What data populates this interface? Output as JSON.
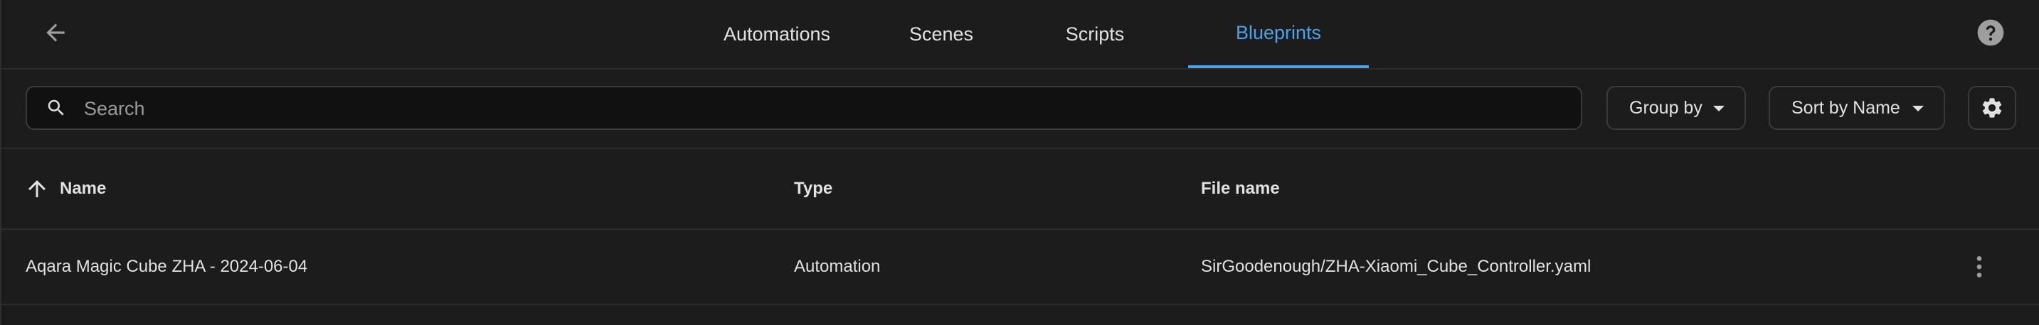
{
  "header": {
    "tabs": [
      {
        "label": "Automations",
        "active": false
      },
      {
        "label": "Scenes",
        "active": false
      },
      {
        "label": "Scripts",
        "active": false
      },
      {
        "label": "Blueprints",
        "active": true
      }
    ],
    "back_icon": "arrow-left-icon",
    "help_icon": "help-circle-icon"
  },
  "toolbar": {
    "search_placeholder": "Search",
    "search_value": "",
    "group_by_label": "Group by",
    "sort_by_label": "Sort by Name",
    "settings_icon": "gear-icon"
  },
  "table": {
    "columns": [
      "Name",
      "Type",
      "File name"
    ],
    "sort_icon": "arrow-up-icon",
    "rows": [
      {
        "name": "Aqara Magic Cube ZHA - 2024-06-04",
        "type": "Automation",
        "file_name": "SirGoodenough/ZHA-Xiaomi_Cube_Controller.yaml"
      }
    ]
  },
  "colors": {
    "accent": "#4aa3e8",
    "background": "#111111",
    "surface": "#1c1c1c",
    "text": "#e1e1e1"
  }
}
